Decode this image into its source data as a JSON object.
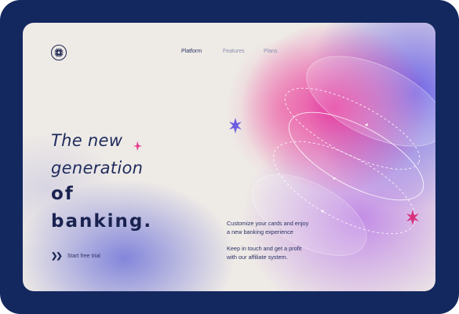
{
  "nav": {
    "items": [
      {
        "label": "Platform"
      },
      {
        "label": "Features"
      },
      {
        "label": "Plans"
      }
    ]
  },
  "hero": {
    "lines": [
      "The new",
      "generation",
      "of",
      "banking."
    ],
    "cta_label": "Start free trial"
  },
  "info": {
    "paragraph1": [
      "Customize your cards and enjoy",
      "a new banking experience"
    ],
    "paragraph2": [
      "Keep in touch and get a profit",
      "with our affiliate system."
    ]
  },
  "colors": {
    "frame": "#13285e",
    "card": "#eeeae6",
    "text": "#1f2a5c",
    "accent_pink": "#e83a8f",
    "accent_purple": "#6b5ee0"
  },
  "icons": [
    "starburst-logo-icon",
    "double-chevron-icon",
    "sparkle-icon"
  ]
}
